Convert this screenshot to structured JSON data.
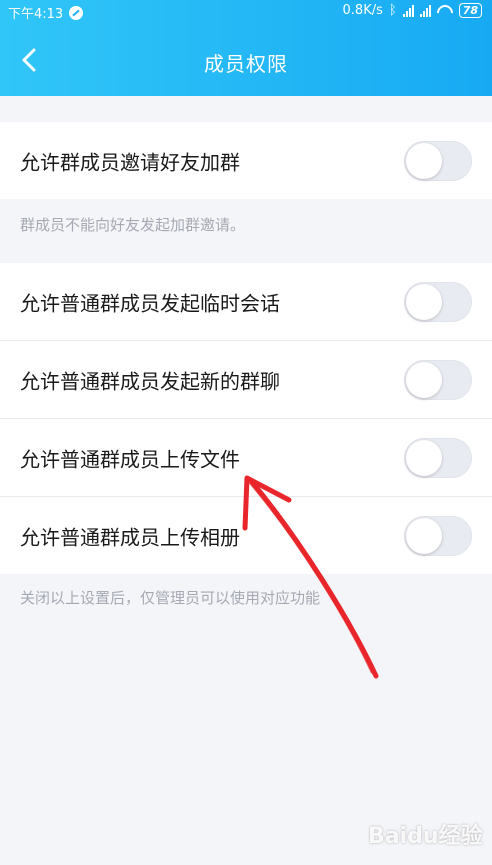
{
  "status_bar": {
    "time": "下午4:13",
    "speed": "0.8K/s",
    "battery": "78"
  },
  "header": {
    "title": "成员权限"
  },
  "section1": {
    "rows": [
      {
        "label": "允许群成员邀请好友加群",
        "enabled": false
      }
    ],
    "hint": "群成员不能向好友发起加群邀请。"
  },
  "section2": {
    "rows": [
      {
        "label": "允许普通群成员发起临时会话",
        "enabled": false
      },
      {
        "label": "允许普通群成员发起新的群聊",
        "enabled": false
      },
      {
        "label": "允许普通群成员上传文件",
        "enabled": false
      },
      {
        "label": "允许普通群成员上传相册",
        "enabled": false
      }
    ],
    "hint": "关闭以上设置后，仅管理员可以使用对应功能"
  },
  "colors": {
    "header_start": "#31c6f8",
    "header_end": "#17aaf3",
    "annotation_arrow": "#e8262b"
  },
  "watermark": "Baidu经验"
}
